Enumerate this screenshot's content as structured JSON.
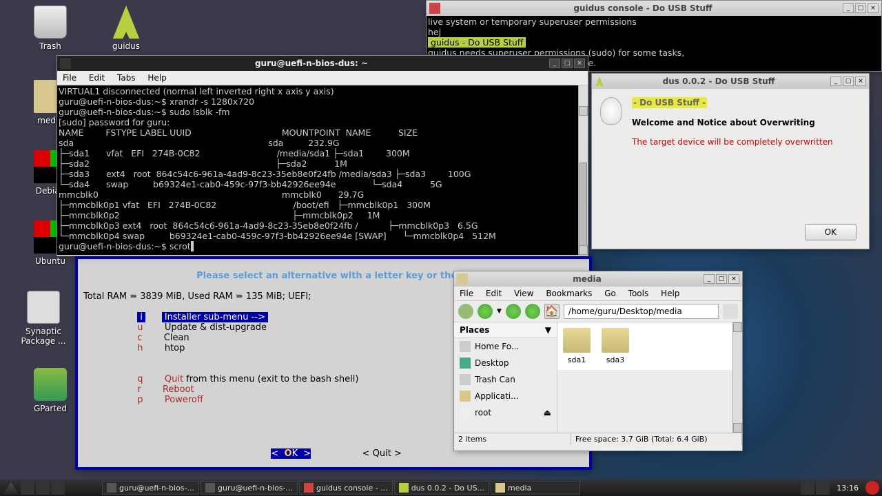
{
  "desktop": {
    "icons": [
      {
        "name": "trash",
        "label": "Trash"
      },
      {
        "name": "guidus",
        "label": "guidus"
      },
      {
        "name": "media",
        "label": "media"
      },
      {
        "name": "debian",
        "label": "Debian"
      },
      {
        "name": "ubuntu",
        "label": "Ubuntu"
      },
      {
        "name": "synaptic",
        "label": "Synaptic Package ..."
      },
      {
        "name": "gparted",
        "label": "GParted"
      }
    ]
  },
  "guidus_console": {
    "title": "guidus console - Do USB Stuff",
    "lines_pre": "live system or temporary superuser permissions\nhej",
    "banner": " guidus - Do USB Stuff ",
    "lines_post": "guidus needs superuser permissions (sudo) for some tasks,\n             e to the target, a block device."
  },
  "terminal": {
    "title": "guru@uefi-n-bios-dus: ~",
    "menu": [
      "File",
      "Edit",
      "Tabs",
      "Help"
    ],
    "body": "VIRTUAL1 disconnected (normal left inverted right x axis y axis)\nguru@uefi-n-bios-dus:~$ xrandr -s 1280x720\nguru@uefi-n-bios-dus:~$ sudo lsblk -fm\n[sudo] password for guru:\nNAME        FSTYPE LABEL UUID                                 MOUNTPOINT  NAME          SIZE\nsda                                                                       sda         232.9G\n├─sda1      vfat   EFI   274B-0C82                            /media/sda1 ├─sda1        300M\n├─sda2                                                                    ├─sda2          1M\n├─sda3      ext4   root  864c54c6-961a-4ad9-8c23-35eb8e0f24fb /media/sda3 ├─sda3        100G\n└─sda4      swap         b69324e1-cab0-459c-97f3-bb42926ee94e             └─sda4          5G\nmmcblk0                                                                   mmcblk0      29.7G\n├─mmcblk0p1 vfat   EFI   274B-0C82                            /boot/efi   ├─mmcblk0p1   300M\n├─mmcblk0p2                                                               ├─mmcblk0p2     1M\n├─mmcblk0p3 ext4   root  864c54c6-961a-4ad9-8c23-35eb8e0f24fb /           ├─mmcblk0p3   6.5G\n└─mmcblk0p4 swap         b69324e1-cab0-459c-97f3-bb42926ee94e [SWAP]      └─mmcblk0p4   512M\nguru@uefi-n-bios-dus:~$ scrot"
  },
  "installer_menu": {
    "header": "Please select an alternative with a letter key or the ar",
    "ram": "Total RAM = 3839 MiB, Used RAM = 135 MiB; UEFI;",
    "items": [
      {
        "key": "i",
        "label": " Installer sub-menu --> ",
        "sel": true
      },
      {
        "key": "u",
        "label": "Update & dist-upgrade"
      },
      {
        "key": "c",
        "label": "Clean"
      },
      {
        "key": "h",
        "label": "htop"
      }
    ],
    "quit_items": [
      {
        "key": "q",
        "lab1": "Quit",
        "lab2": " from this menu (exit to the bash shell)"
      },
      {
        "key": "r",
        "lab1": "Reboot",
        "lab2": ""
      },
      {
        "key": "p",
        "lab1": "Poweroff",
        "lab2": ""
      }
    ],
    "ok_btn": "<  OK  >",
    "quit_btn": "< Quit >"
  },
  "dus_dialog": {
    "title": "dus 0.0.2 - Do USB Stuff",
    "heading": " - Do USB Stuff - ",
    "subhead": "Welcome and Notice about Overwriting",
    "warn": "The target device will be completely overwritten",
    "ok": "OK"
  },
  "file_manager": {
    "title": "media",
    "menu": [
      "File",
      "Edit",
      "View",
      "Bookmarks",
      "Go",
      "Tools",
      "Help"
    ],
    "path": "/home/guru/Desktop/media",
    "places_header": "Places",
    "places": [
      "Home Fo...",
      "Desktop",
      "Trash Can",
      "Applicati...",
      "root"
    ],
    "files": [
      "sda1",
      "sda3"
    ],
    "status_left": "2 items",
    "status_right": "Free space: 3.7 GiB (Total: 6.4 GiB)"
  },
  "panel": {
    "tasks": [
      "guru@uefi-n-bios-...",
      "guru@uefi-n-bios-...",
      "guidus console - ...",
      "dus 0.0.2 - Do US...",
      "media"
    ],
    "clock": "13:16"
  }
}
